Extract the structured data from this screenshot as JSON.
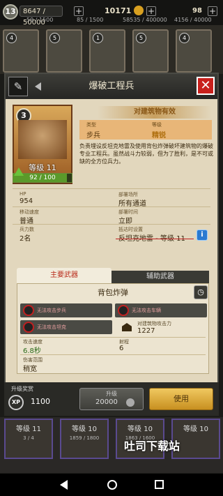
{
  "topbar": {
    "player_level": "13",
    "xp": "8647 / 50000",
    "res1": "59 / 1500",
    "res2": "85 / 1500",
    "gold": "10171",
    "res3": "58535 / 400000",
    "res4": "4156 / 40000",
    "gems": "98"
  },
  "strip_cards": [
    {
      "n": "4"
    },
    {
      "n": "5"
    },
    {
      "n": "1"
    },
    {
      "n": "5"
    },
    {
      "n": "4"
    }
  ],
  "modal": {
    "title": "爆破工程兵",
    "card": {
      "number": "3",
      "level": "等级 11",
      "xp": "92 / 100",
      "xp_fraction": 0.92
    },
    "banner": "对建筑物有效",
    "type_label": "类型",
    "type_value": "步兵",
    "grade_label": "等级",
    "grade_value": "精锐",
    "description": "负责埋设反坦克地雷及使用背包炸弹破坏建筑物的爆破专业工程兵。虽然战斗力较弱，但为了胜利，是不可或缺的全方位兵力。",
    "stats": {
      "hp_label": "HP",
      "hp": "954",
      "deploy_label": "部署场所",
      "deploy": "所有通道",
      "speed_label": "移动速度",
      "speed": "普通",
      "deploy_time_label": "部署时间",
      "deploy_time": "立即",
      "troops_label": "兵力数",
      "troops": "2名",
      "defense_label": "抵达时设置",
      "defense": "反坦克地雷 - 等级 11"
    },
    "tabs": {
      "primary": "主要武器",
      "secondary": "辅助武器"
    },
    "weapon": {
      "name": "背包炸弹",
      "cannot1": "无法攻击步兵",
      "cannot2": "无法攻击车辆",
      "cannot3": "无法攻击坦克",
      "building_label": "对建筑物攻击力",
      "building_value": "1227",
      "atkspeed_label": "攻击速度",
      "atkspeed": "6.8秒",
      "range_label": "射程",
      "range": "6",
      "area_label": "伤害范围",
      "area": "稍宽"
    },
    "reward_label": "升级奖赏",
    "xp_icon": "XP",
    "reward_value": "1100",
    "upgrade_label": "升级",
    "upgrade_cost": "20000",
    "use_label": "使用"
  },
  "bottom_cards": [
    {
      "lv": "等级 11",
      "cnt": "3 / 4"
    },
    {
      "lv": "等级 10",
      "cnt": "1859 / 1800"
    },
    {
      "lv": "等级 10",
      "cnt": "1863 / 1600"
    },
    {
      "lv": "等级 10",
      "cnt": ""
    }
  ],
  "watermark": "吐司下载站"
}
